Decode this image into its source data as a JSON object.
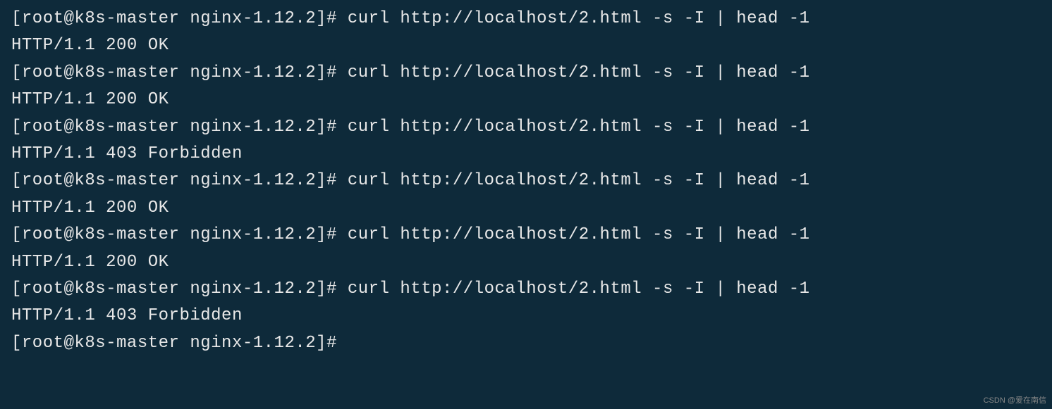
{
  "terminal": {
    "lines": [
      "[root@k8s-master nginx-1.12.2]# curl http://localhost/2.html -s -I | head -1",
      "HTTP/1.1 200 OK",
      "[root@k8s-master nginx-1.12.2]# curl http://localhost/2.html -s -I | head -1",
      "HTTP/1.1 200 OK",
      "[root@k8s-master nginx-1.12.2]# curl http://localhost/2.html -s -I | head -1",
      "HTTP/1.1 403 Forbidden",
      "[root@k8s-master nginx-1.12.2]# curl http://localhost/2.html -s -I | head -1",
      "HTTP/1.1 200 OK",
      "[root@k8s-master nginx-1.12.2]# curl http://localhost/2.html -s -I | head -1",
      "HTTP/1.1 200 OK",
      "[root@k8s-master nginx-1.12.2]# curl http://localhost/2.html -s -I | head -1",
      "HTTP/1.1 403 Forbidden",
      "[root@k8s-master nginx-1.12.2]#"
    ]
  },
  "watermark": "CSDN @爱在南信"
}
